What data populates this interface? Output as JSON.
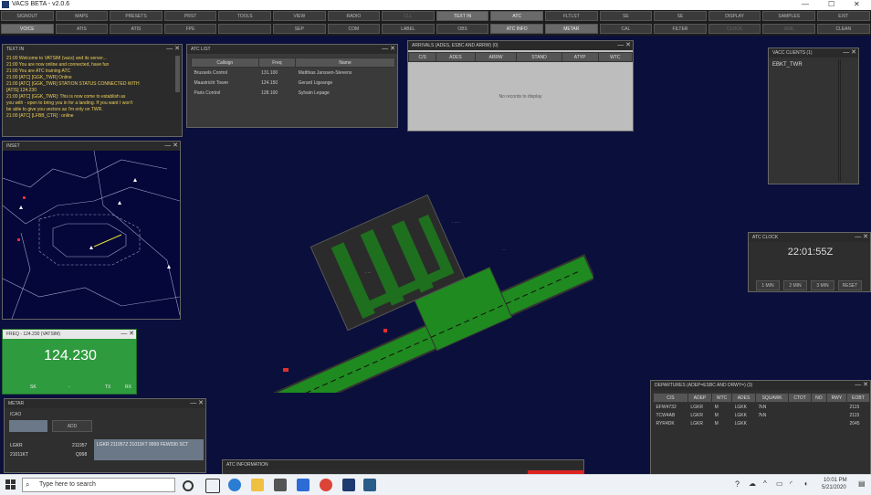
{
  "titlebar": {
    "title": "VACS BETA - v2.0.6",
    "minimize": "—",
    "maximize": "☐",
    "close": "✕"
  },
  "toolbar_row1": [
    "SIGNOUT",
    "MAPS",
    "PRESETS",
    "PRST",
    "TOOLS",
    "VIEW",
    "RADIO",
    "CLL",
    "TEXT IN",
    "ATC",
    "FLTLST",
    "SE",
    "SE",
    "DISPLAY",
    "SAMPLES",
    "EXIT"
  ],
  "toolbar_row2": [
    "VOICE",
    "ATIS",
    "ATIS",
    "FPE",
    "",
    "SEP",
    "COM",
    "LABEL",
    "OBS",
    "ATC INFO",
    "METAR",
    "CAL",
    "FILTER",
    "CLOCK",
    "ADE",
    "CLEAN"
  ],
  "textin": {
    "title": "TEXT IN",
    "lines": [
      "21:00 Welcome to VATSIM (vacs) and its server...",
      "21:00 You are now online and connected, have fun",
      "21:00 You are ATC training ATC",
      "21:00 [ATC] [GGK_TWR] Online",
      "21:00 [ATC] [GGK_TWR] STATION STATUS CONNECTED WITH",
      "[ATIS] 124.230",
      "21:00 [ATC] [GGK_TWR]: This is now come to establish as",
      "you with - open to bring you in for a landing. If you want I won't",
      "be able to give you vectors as I'm only on TWR.",
      "21:00 [ATC] [LFBB_CTR] : online"
    ]
  },
  "atclist": {
    "title": "ATC LIST",
    "headers": [
      "Callsign",
      "Freq",
      "Name"
    ],
    "rows": [
      {
        "c": "Brussels Control",
        "f": "131.100",
        "n": "Matthias Janssen-Stevens"
      },
      {
        "c": "Maastricht Tower",
        "f": "124.150",
        "n": "Gerard Ligeange"
      },
      {
        "c": "Paris Control",
        "f": "128.100",
        "n": "Sylvain Lepage"
      }
    ]
  },
  "arrivals": {
    "title": "ARRIVALS (ADES, ESBC AND ARRW) (0)",
    "headers": [
      "C/S",
      "ADES",
      "ARRW",
      "STAND",
      "ATYP",
      "WTC"
    ],
    "empty": "No records to display"
  },
  "vaccalist": {
    "title": "VACC CLIENTS (1)",
    "rows": [
      "EBKT_TWR"
    ]
  },
  "inset": {
    "title": "INSET"
  },
  "clock": {
    "title": "ATC CLOCK",
    "time": "22:01:55Z",
    "buttons": [
      "1 MIN",
      "2 MIN",
      "3 MIN",
      "RESET"
    ]
  },
  "freq": {
    "title": "FREQ - 124.230 (VATSIM)",
    "value": "124.230",
    "buttons": [
      "SK",
      "-",
      "TX",
      "RX"
    ]
  },
  "metar": {
    "title": "METAR",
    "icao_label": "ICAO",
    "add": "ADD",
    "rows": [
      {
        "station": "LGKR",
        "time": "211957",
        "val": "LGKR 211957Z 21011KT 9999 FEW030 SCT"
      },
      {
        "station": "21011KT",
        "time": "Q998",
        "val": ""
      }
    ]
  },
  "departures": {
    "title": "DEPARTURES (ADEP=ESBC AND DRWY=) (3)",
    "headers": [
      "C/S",
      "ADEP",
      "WTC",
      "ADES",
      "SQUAWK",
      "CTOT",
      "NO",
      "RWY",
      "EOBT"
    ],
    "rows": [
      {
        "cs": "EFW4732",
        "adep": "LGKR",
        "wtc": "M",
        "ades": "LGKK",
        "sq": "7kN",
        "ctot": "",
        "no": "",
        "rwy": "",
        "eobt": "2115"
      },
      {
        "cs": "TCW4AB",
        "adep": "LGKR",
        "wtc": "M",
        "ades": "LGKK",
        "sq": "7kN",
        "ctot": "",
        "no": "",
        "rwy": "",
        "eobt": "2115"
      },
      {
        "cs": "RYR4DK",
        "adep": "LGKR",
        "wtc": "M",
        "ades": "LGKK",
        "sq": "",
        "ctot": "",
        "no": "",
        "rwy": "",
        "eobt": "2045"
      }
    ]
  },
  "atcinfo": {
    "title": "ATC INFORMATION"
  },
  "taskbar": {
    "search": "Type here to search",
    "time": "10:01 PM",
    "date": "5/21/2020"
  },
  "colors": {
    "runway_green": "#1f8a1f",
    "freq_green": "#2e9b3e",
    "background": "#0a0f3c"
  }
}
